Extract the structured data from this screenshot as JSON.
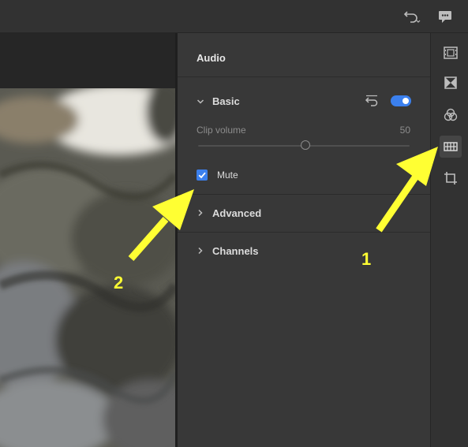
{
  "panel": {
    "title": "Audio"
  },
  "basic": {
    "label": "Basic",
    "enabled": true,
    "clip_volume_label": "Clip volume",
    "clip_volume_value": "50",
    "clip_volume_level": 0.5,
    "mute_label": "Mute",
    "mute_checked": true
  },
  "sections": {
    "advanced": "Advanced",
    "channels": "Channels"
  },
  "rail": {
    "items": [
      {
        "icon": "film-strip-icon"
      },
      {
        "icon": "transition-icon"
      },
      {
        "icon": "color-circles-icon"
      },
      {
        "icon": "audio-waveform-icon",
        "active": true
      },
      {
        "icon": "crop-icon"
      }
    ]
  },
  "annotations": {
    "callout_1": "1",
    "callout_2": "2"
  },
  "colors": {
    "accent": "#3b80ee",
    "callout": "#ffff33",
    "panel_bg": "#383838"
  }
}
